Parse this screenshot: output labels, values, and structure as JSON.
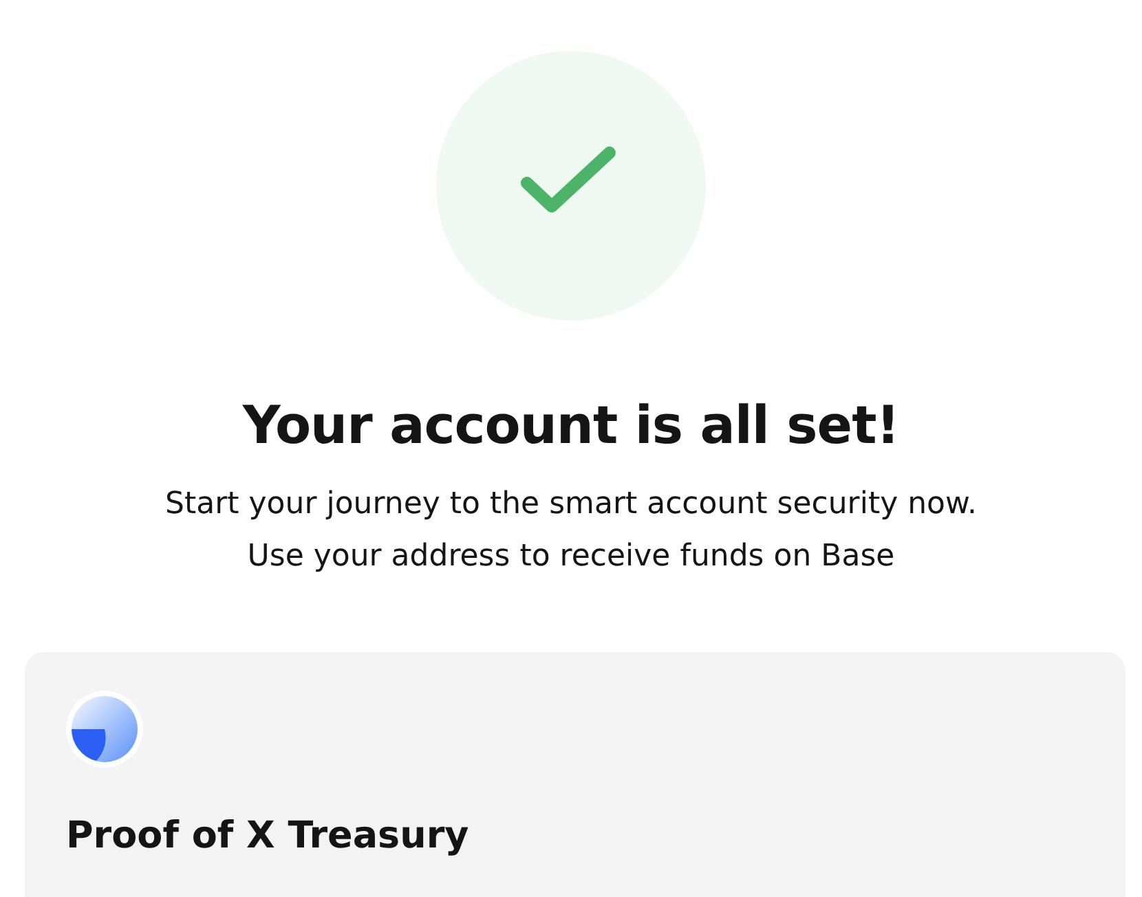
{
  "status": {
    "kind": "success"
  },
  "title": "Your account is all set!",
  "description": [
    "Start your journey to the smart account security now.",
    "Use your address to receive funds on Base"
  ],
  "account_card": {
    "name": "Proof of X Treasury"
  }
}
